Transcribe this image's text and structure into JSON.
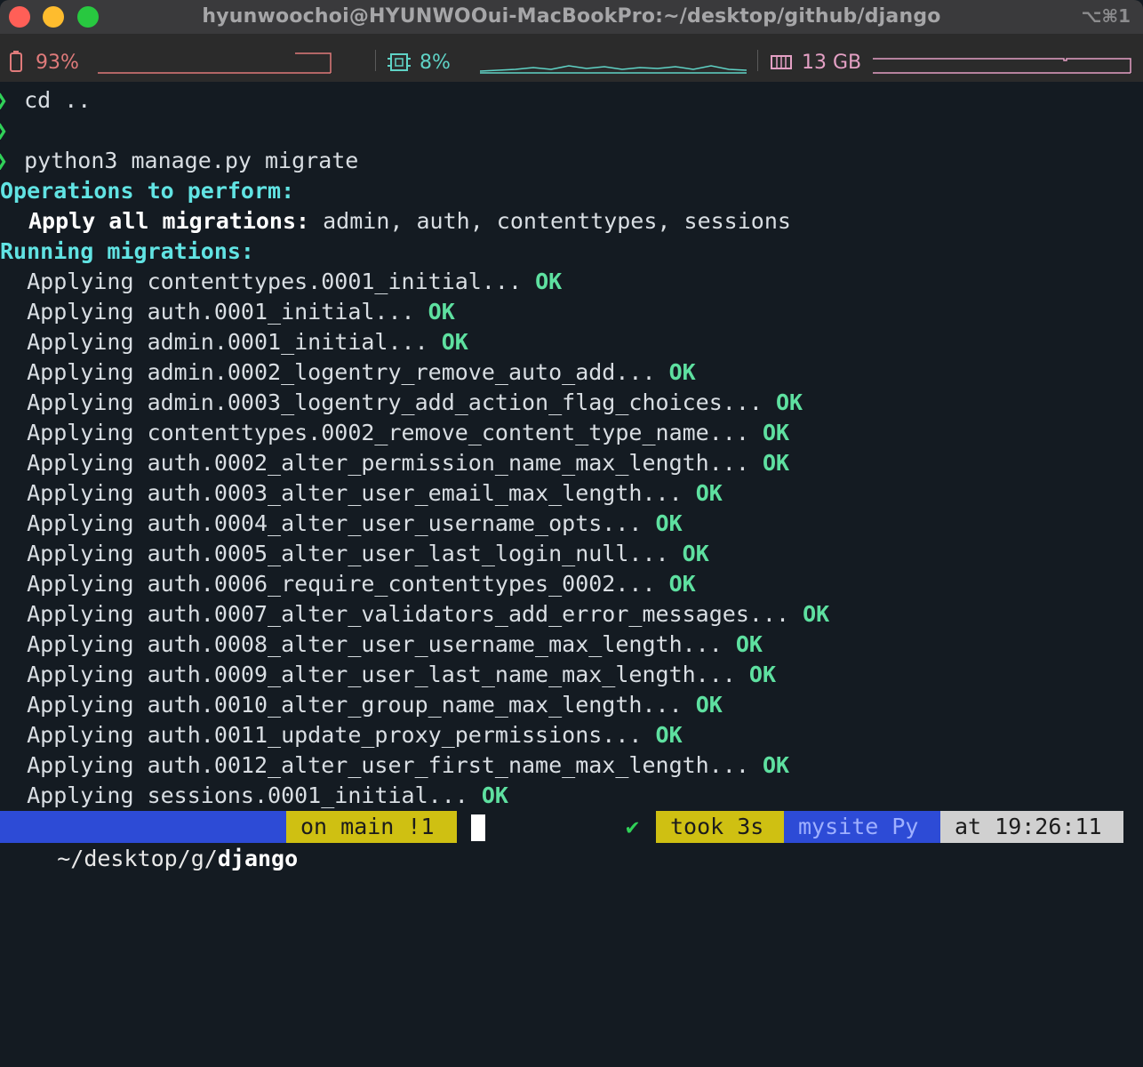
{
  "window": {
    "title": "hyunwoochoi@HYUNWOOui-MacBookPro:~/desktop/github/django",
    "shortcut": "⌥⌘1",
    "traffic_lights": {
      "close": "#ff5f57",
      "minimize": "#febc2e",
      "zoom": "#28c840"
    }
  },
  "status": {
    "battery": {
      "icon": "battery-icon",
      "value": "93%",
      "color": "#e07b7b"
    },
    "cpu": {
      "icon": "cpu-icon",
      "value": "8%",
      "color": "#5fd3c6"
    },
    "memory": {
      "icon": "memory-icon",
      "value": "13 GB",
      "color": "#e4a0c4"
    }
  },
  "terminal": {
    "lines": [
      {
        "type": "cmd",
        "prompt": "❯",
        "text": "cd .."
      },
      {
        "type": "cmd",
        "prompt": "❯",
        "text": ""
      },
      {
        "type": "cmd",
        "prompt": "❯",
        "text": "python3 manage.py migrate"
      },
      {
        "type": "heading",
        "text": "Operations to perform:"
      },
      {
        "type": "detail",
        "label": "Apply all migrations:",
        "text": " admin, auth, contenttypes, sessions"
      },
      {
        "type": "heading",
        "text": "Running migrations:"
      },
      {
        "type": "migration",
        "text": "  Applying contenttypes.0001_initial...",
        "status": "OK"
      },
      {
        "type": "migration",
        "text": "  Applying auth.0001_initial...",
        "status": "OK"
      },
      {
        "type": "migration",
        "text": "  Applying admin.0001_initial...",
        "status": "OK"
      },
      {
        "type": "migration",
        "text": "  Applying admin.0002_logentry_remove_auto_add...",
        "status": "OK"
      },
      {
        "type": "migration",
        "text": "  Applying admin.0003_logentry_add_action_flag_choices...",
        "status": "OK"
      },
      {
        "type": "migration",
        "text": "  Applying contenttypes.0002_remove_content_type_name...",
        "status": "OK"
      },
      {
        "type": "migration",
        "text": "  Applying auth.0002_alter_permission_name_max_length...",
        "status": "OK"
      },
      {
        "type": "migration",
        "text": "  Applying auth.0003_alter_user_email_max_length...",
        "status": "OK"
      },
      {
        "type": "migration",
        "text": "  Applying auth.0004_alter_user_username_opts...",
        "status": "OK"
      },
      {
        "type": "migration",
        "text": "  Applying auth.0005_alter_user_last_login_null...",
        "status": "OK"
      },
      {
        "type": "migration",
        "text": "  Applying auth.0006_require_contenttypes_0002...",
        "status": "OK"
      },
      {
        "type": "migration",
        "text": "  Applying auth.0007_alter_validators_add_error_messages...",
        "status": "OK"
      },
      {
        "type": "migration",
        "text": "  Applying auth.0008_alter_user_username_max_length...",
        "status": "OK"
      },
      {
        "type": "migration",
        "text": "  Applying auth.0009_alter_user_last_name_max_length...",
        "status": "OK"
      },
      {
        "type": "migration",
        "text": "  Applying auth.0010_alter_group_name_max_length...",
        "status": "OK"
      },
      {
        "type": "migration",
        "text": "  Applying auth.0011_update_proxy_permissions...",
        "status": "OK"
      },
      {
        "type": "migration",
        "text": "  Applying auth.0012_alter_user_first_name_max_length...",
        "status": "OK"
      },
      {
        "type": "migration",
        "text": "  Applying sessions.0001_initial...",
        "status": "OK"
      }
    ]
  },
  "prompt_bar": {
    "path_prefix": "~/desktop/g/",
    "path_dir": "django",
    "git": "on main !1",
    "check": "✔",
    "took": "took 3s",
    "env": "mysite Py",
    "time": "at 19:26:11",
    "colors": {
      "path_bg": "#2d4bd6",
      "git_bg": "#cfc012",
      "took_bg": "#cfc012",
      "env_bg": "#2d4bd6",
      "time_bg": "#d0d0d0"
    }
  }
}
